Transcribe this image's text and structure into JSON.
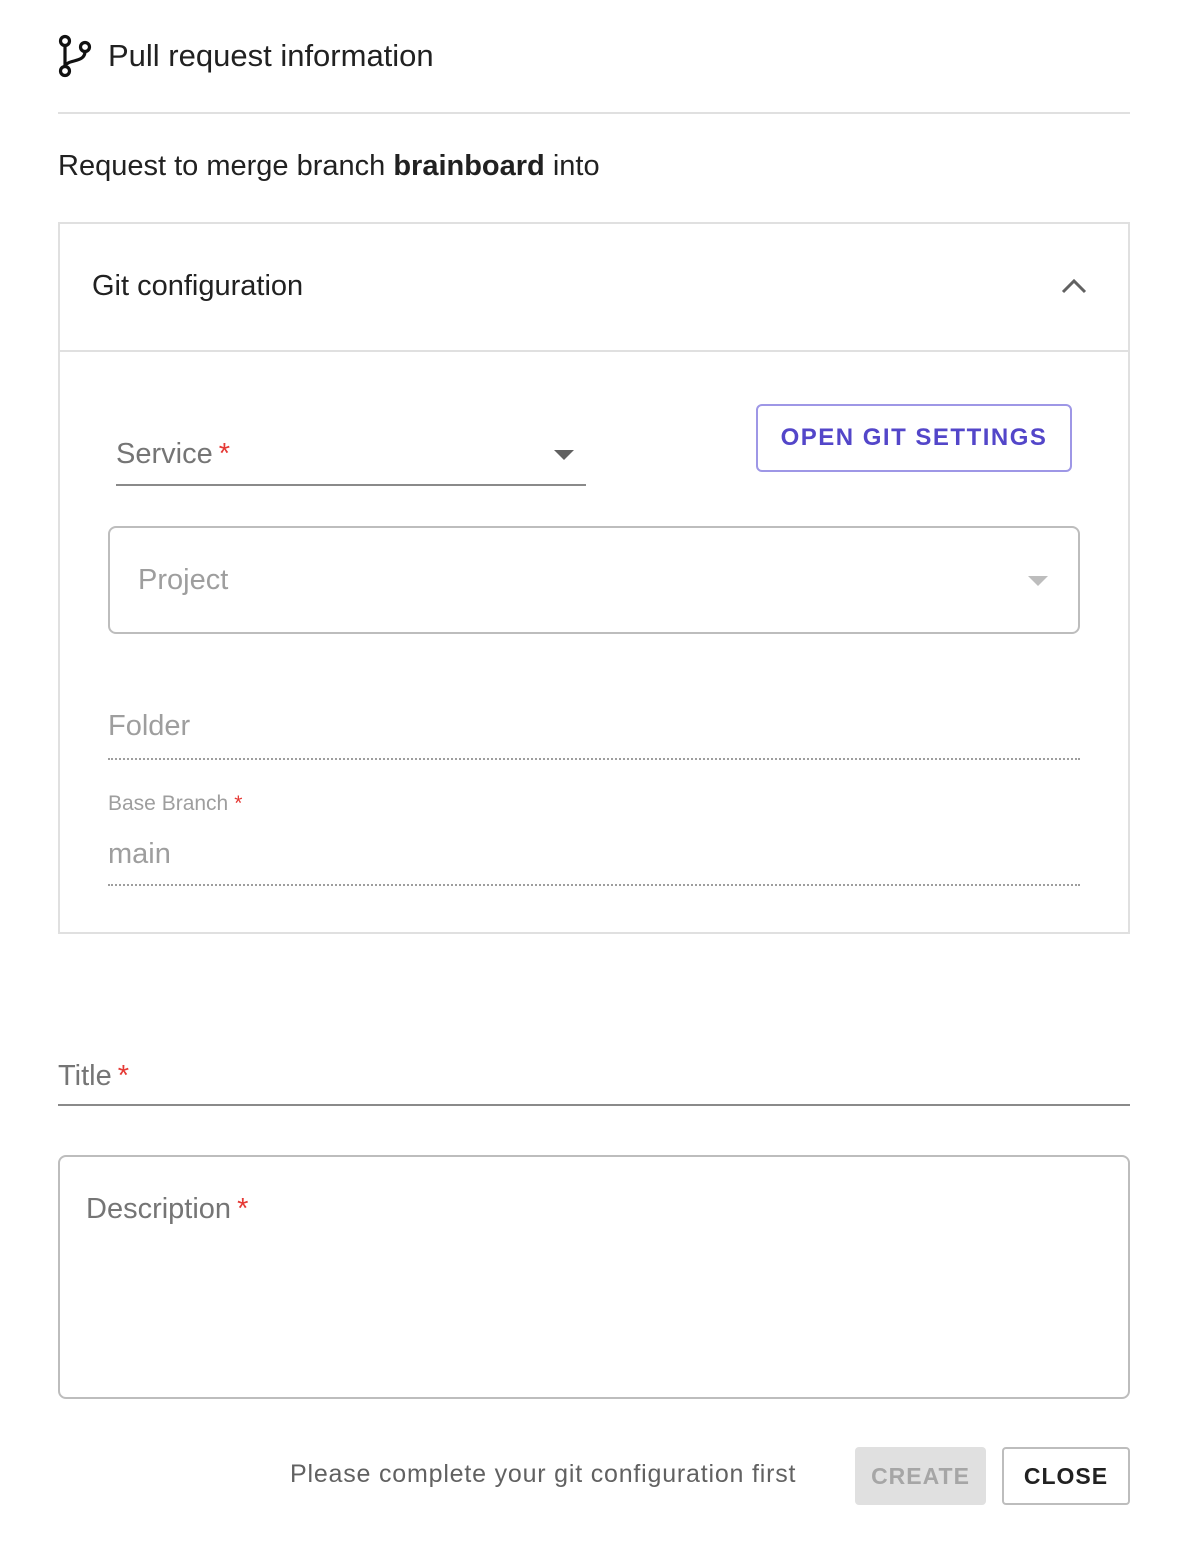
{
  "header": {
    "title": "Pull request information",
    "icon": "git-branch-icon"
  },
  "subtitle": {
    "prefix": "Request to merge branch",
    "branch": "brainboard",
    "suffix": "into"
  },
  "git_config": {
    "title": "Git configuration",
    "expanded": true,
    "toggle_icon": "chevron-up-icon",
    "service": {
      "label": "Service",
      "required_mark": "*"
    },
    "open_settings_label": "OPEN GIT SETTINGS",
    "project": {
      "label": "Project"
    },
    "folder": {
      "label": "Folder"
    },
    "base_branch": {
      "label": "Base Branch",
      "required_mark": "*",
      "value": "main"
    }
  },
  "title_field": {
    "label": "Title",
    "required_mark": "*"
  },
  "description_field": {
    "label": "Description",
    "required_mark": "*"
  },
  "footer": {
    "message": "Please complete your git configuration first",
    "create_label": "CREATE",
    "create_disabled": true,
    "close_label": "CLOSE"
  },
  "colors": {
    "accent": "#5346c9",
    "required": "#e53935",
    "border": "#e0e0e0"
  }
}
